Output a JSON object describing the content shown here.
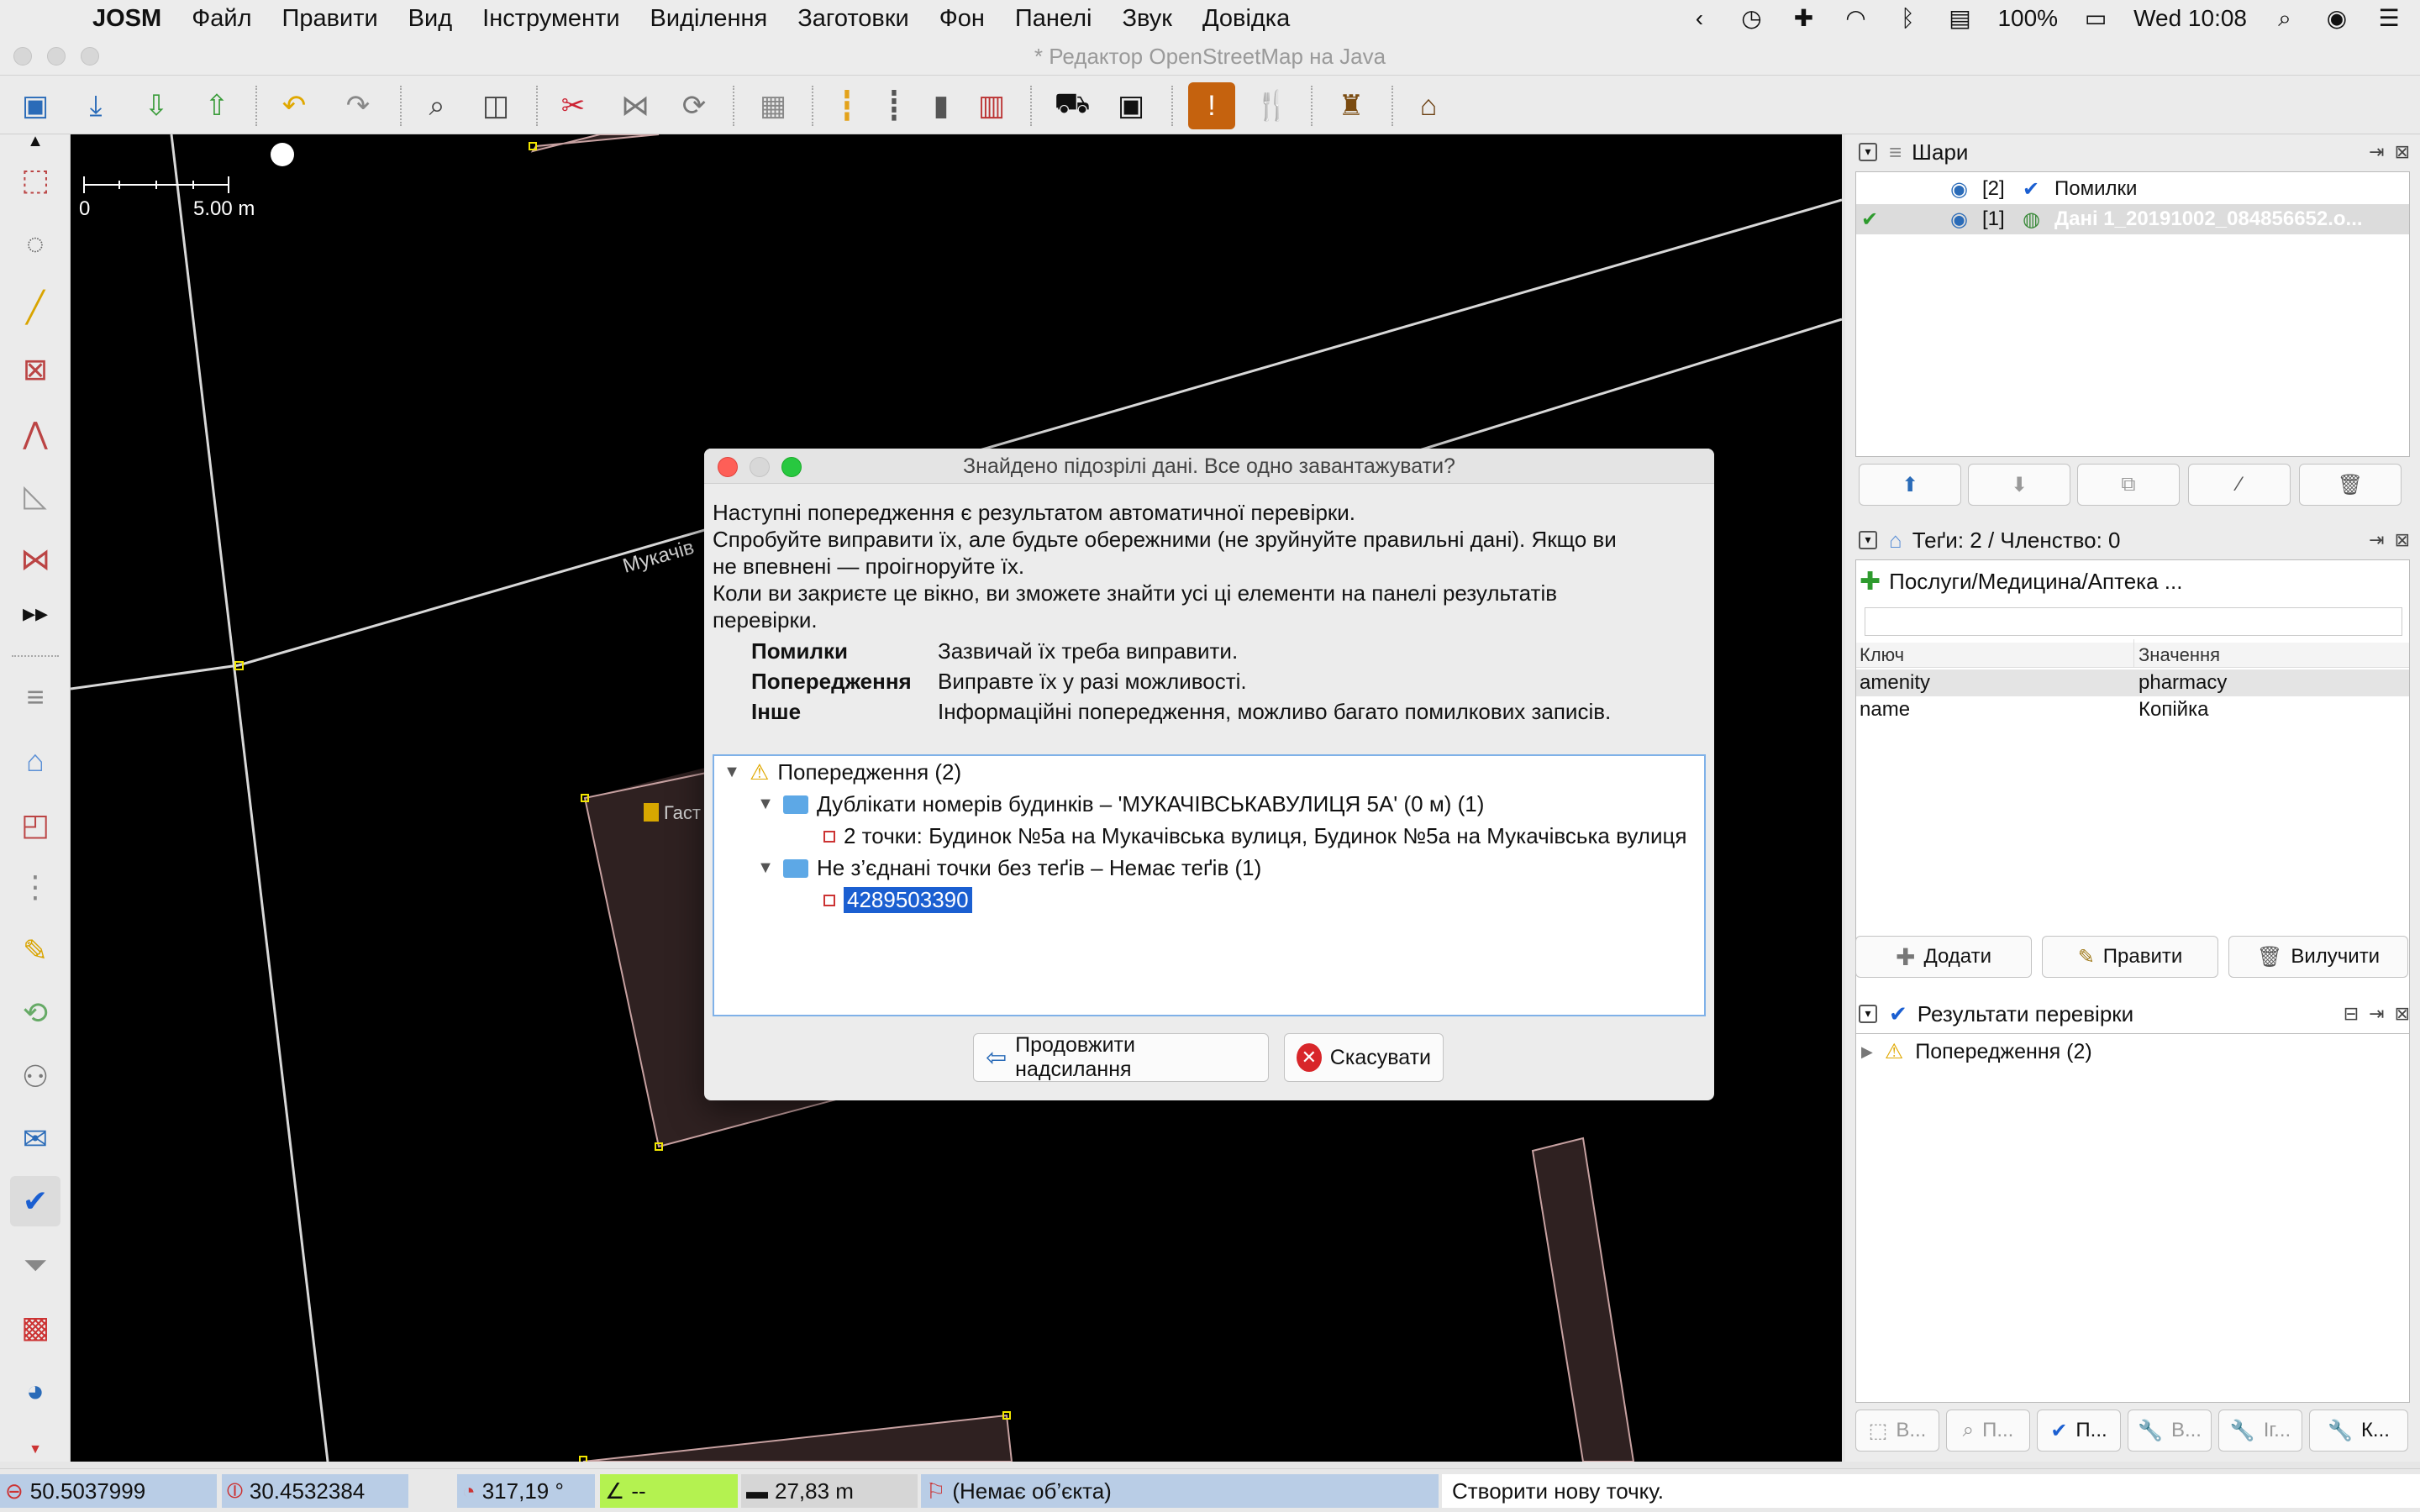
{
  "menubar": {
    "app_name": "JOSM",
    "items": [
      "Файл",
      "Правити",
      "Вид",
      "Інструменти",
      "Виділення",
      "Заготовки",
      "Фон",
      "Панелі",
      "Звук",
      "Довідка"
    ],
    "battery": "100%",
    "clock": "Wed 10:08"
  },
  "window": {
    "title": "* Редактор OpenStreetMap на Java"
  },
  "map": {
    "scale_zero": "0",
    "scale_label": "5.00 m",
    "street_label": "Мукачів",
    "poi_label": "Гаст"
  },
  "layers_panel": {
    "title": "Шари",
    "rows": [
      {
        "index": "[2]",
        "name": "Помилки"
      },
      {
        "index": "[1]",
        "name": "Дані 1_20191002_084856652.o..."
      }
    ]
  },
  "tags_panel": {
    "title": "Теґи: 2 / Членство: 0",
    "preset": "Послуги/Медицина/Аптека ...",
    "col_key": "Ключ",
    "col_value": "Значення",
    "rows": [
      {
        "key": "amenity",
        "value": "pharmacy"
      },
      {
        "key": "name",
        "value": "Копійка"
      }
    ],
    "add_label": "Додати",
    "edit_label": "Правити",
    "delete_label": "Вилучити"
  },
  "validation_panel": {
    "title": "Результати перевірки",
    "tree_root": "Попередження (2)",
    "bottom_buttons": [
      "В...",
      "П...",
      "П...",
      "В...",
      "Іг...",
      "К..."
    ]
  },
  "statusbar": {
    "lat": "50.5037999",
    "lon": "30.4532384",
    "heading": "317,19 °",
    "angle": "--",
    "distance": "27,83 m",
    "object": "(Немає об’єкта)",
    "message": "Створити нову точку."
  },
  "dialog": {
    "title": "Знайдено підозрілі дані. Все одно завантажувати?",
    "intro_lines": [
      "Наступні попередження є результатом автоматичної перевірки.",
      "Спробуйте виправити їх, але будьте обережними (не зруйнуйте правильні дані). Якщо ви",
      "не впевнені — проігноруйте їх.",
      "Коли ви закриєте це вікно, ви зможете знайти усі ці елементи на панелі результатів",
      "перевірки."
    ],
    "legend": [
      {
        "k": "Помилки",
        "v": "Зазвичай їх треба виправити."
      },
      {
        "k": "Попередження",
        "v": "Виправте їх у разі можливості."
      },
      {
        "k": "Інше",
        "v": "Інформаційні попередження, можливо багато помилкових записів."
      }
    ],
    "tree": {
      "root": "Попередження (2)",
      "group1": "Дублікати номерів будинків – 'МУКАЧІВСЬКАВУЛИЦЯ 5А' (0 м) (1)",
      "group1_item": "2 точки: Будинок №5а на Мукачівська вулиця, Будинок №5а на Мукачівська вулиця",
      "group2": "Не з’єднані точки без теґів – Немає теґів (1)",
      "group2_item": "4289503390"
    },
    "continue_label": "Продовжити надсилання",
    "cancel_label": "Скасувати"
  },
  "colors": {
    "map_bg": "#000000",
    "road": "#d8d8d8",
    "building_outline": "#c7a1a1",
    "building_fill": "#3a2a2a",
    "node": "#f2e600",
    "selection": "#1b5fd1"
  }
}
